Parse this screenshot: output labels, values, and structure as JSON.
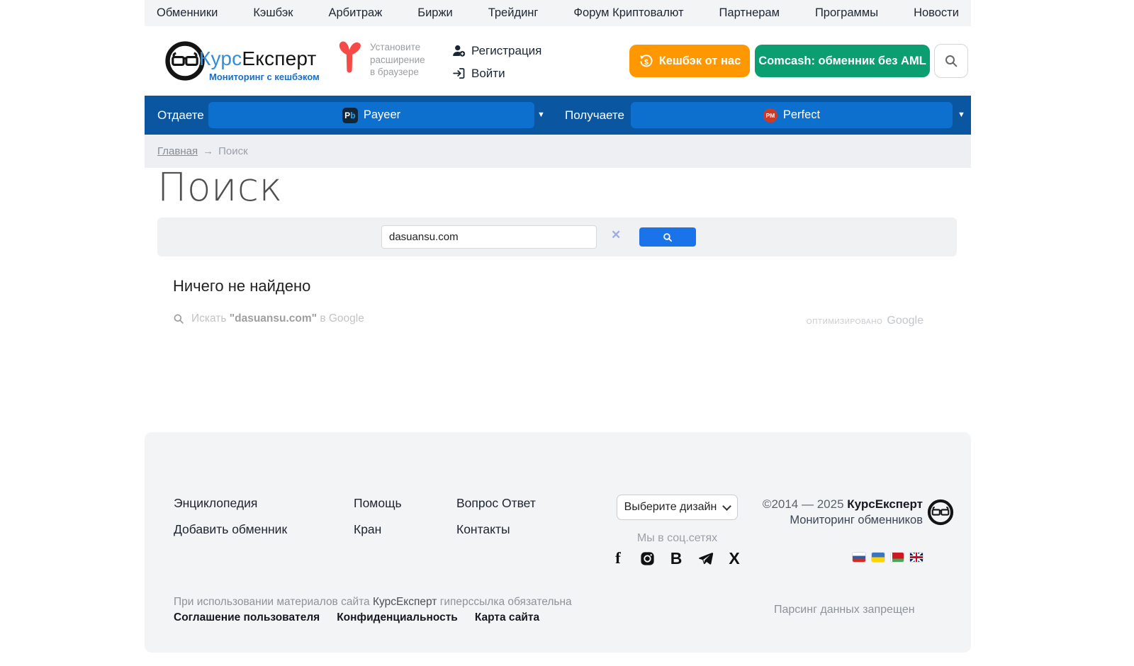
{
  "colors": {
    "brand_blue": "#2f8fdd",
    "subtitle_blue": "#1a6ec6",
    "bar_blue": "#0b56a0",
    "select_blue": "#0e70ce",
    "orange_button": "#ff9800",
    "green_button": "#0a9e71",
    "google_button_blue": "#1a73e8",
    "footer_bg": "#f3f4f6"
  },
  "nav": {
    "items": [
      "Обменники",
      "Кэшбэк",
      "Арбитраж",
      "Биржи",
      "Трейдинг",
      "Форум Криптовалют",
      "Партнерам",
      "Программы",
      "Новости"
    ]
  },
  "header": {
    "brand_first": "Курс",
    "brand_second": "Експерт",
    "brand_subtitle": "Мониторинг с кешбэком",
    "extension_line1": "Установите",
    "extension_line2": "расширение",
    "extension_line3": "в браузере",
    "register_label": "Регистрация",
    "login_label": "Войти",
    "cashback_button": "Кешбэк от нас",
    "promo_button": "Comcash: обменник без AML"
  },
  "exchange_bar": {
    "give_label": "Отдаете",
    "give_value": "Payeer",
    "give_icon_p": "P",
    "give_icon_b": "b",
    "get_label": "Получаете",
    "get_value": "Perfect",
    "get_icon_text": "PM",
    "caret": "▼"
  },
  "breadcrumb": {
    "home": "Главная",
    "separator": "→",
    "current": "Поиск"
  },
  "main": {
    "title": "Поиск",
    "search_value": "dasuansu.com",
    "clear_glyph": "✕",
    "no_results": "Ничего не найдено",
    "suggest_prefix": "Искать ",
    "suggest_query": "\"dasuansu.com\"",
    "suggest_suffix": " в Google",
    "branding_small": "оптимизировано",
    "branding_logo": "Google"
  },
  "footer": {
    "col1": [
      "Энциклопедия",
      "Добавить обменник"
    ],
    "col2": [
      "Помощь",
      "Кран"
    ],
    "col3": [
      "Вопрос Ответ",
      "Контакты"
    ],
    "design_select_value": "Выберите дизайн",
    "social_title": "Мы в соц.сетях",
    "social": [
      {
        "name": "facebook",
        "glyph": "f"
      },
      {
        "name": "instagram"
      },
      {
        "name": "vk",
        "glyph": "B"
      },
      {
        "name": "telegram"
      },
      {
        "name": "x",
        "glyph": "X"
      }
    ],
    "languages": [
      "ru",
      "ua",
      "by",
      "en"
    ],
    "copyright_years": "©2014 — 2025 ",
    "copyright_brand": "КурсЕксперт",
    "copyright_line2": "Мониторинг обменников",
    "notice_prefix": "При использовании материалов сайта ",
    "notice_brand": "КурсЕксперт",
    "notice_suffix": " гиперссылка обязательна",
    "bottom_links": [
      "Соглашение пользователя",
      "Конфиденциальность",
      "Карта сайта"
    ],
    "parsing_notice": "Парсинг данных запрещен"
  }
}
